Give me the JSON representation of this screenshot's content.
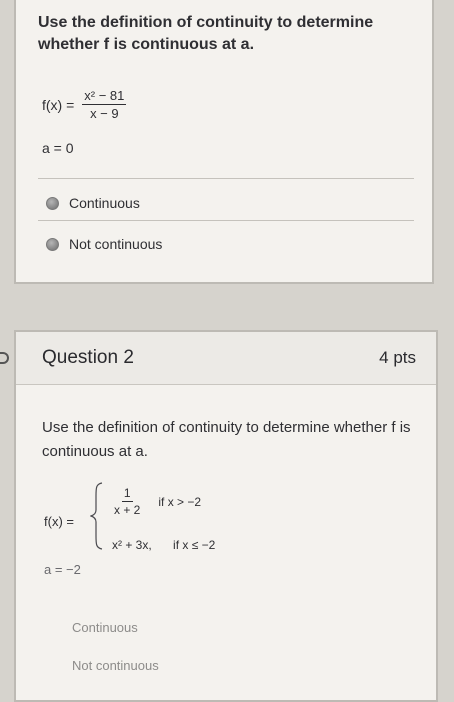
{
  "question1": {
    "prompt": "Use the definition of continuity to determine whether f is continuous at a.",
    "function_lhs": "f(x) =",
    "numerator": "x² − 81",
    "denominator": "x − 9",
    "a_value": "a = 0",
    "options": [
      "Continuous",
      "Not continuous"
    ]
  },
  "question2": {
    "title": "Question 2",
    "points": "4 pts",
    "prompt": "Use the definition of continuity to determine whether f is continuous at a.",
    "function_lhs": "f(x) =",
    "case1_numerator": "1",
    "case1_denominator": "x + 2",
    "case1_condition": "if x > −2",
    "case2_expression": "x² + 3x,",
    "case2_condition": "if x ≤ −2",
    "a_value": "a = −2",
    "options": [
      "Continuous",
      "Not continuous"
    ]
  },
  "colors": {
    "background": "#d6d3cd",
    "card": "#f4f2ee",
    "text": "#2f2f33",
    "faded_text": "#8d8c8a"
  }
}
